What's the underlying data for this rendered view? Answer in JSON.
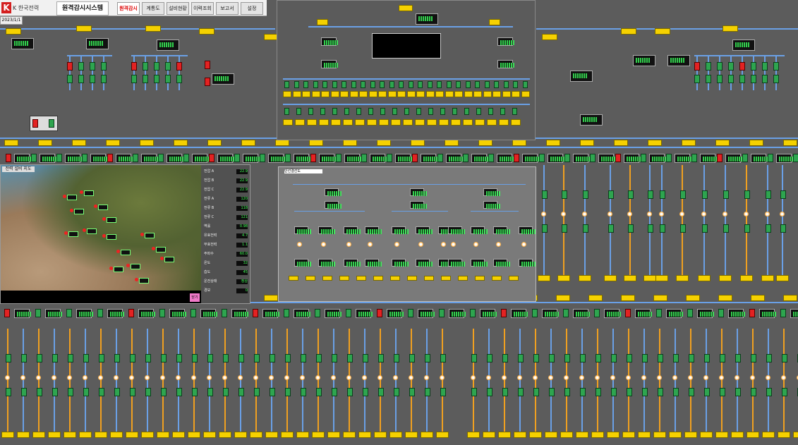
{
  "app": {
    "logo_text": "K 한국전력",
    "system_name": "원격감시시스템",
    "date_label": "2023/1/1"
  },
  "menu": [
    {
      "label": "원격감시",
      "active": true
    },
    {
      "label": "계통도",
      "active": false
    },
    {
      "label": "설비현황",
      "active": false
    },
    {
      "label": "이력조회",
      "active": false
    },
    {
      "label": "보고서",
      "active": false
    },
    {
      "label": "설정",
      "active": false
    }
  ],
  "map_panel": {
    "title": "전력 설비 지도",
    "pink_label": "닫기",
    "stats": [
      {
        "label": "전압 A",
        "value": "22.9"
      },
      {
        "label": "전압 B",
        "value": "22.9"
      },
      {
        "label": "전압 C",
        "value": "22.9"
      },
      {
        "label": "전류 A",
        "value": "120"
      },
      {
        "label": "전류 B",
        "value": "118"
      },
      {
        "label": "전류 C",
        "value": "121"
      },
      {
        "label": "역률",
        "value": "0.98"
      },
      {
        "label": "유효전력",
        "value": "4.7"
      },
      {
        "label": "무효전력",
        "value": "1.1"
      },
      {
        "label": "주파수",
        "value": "60.0"
      },
      {
        "label": "온도",
        "value": "32"
      },
      {
        "label": "습도",
        "value": "45"
      },
      {
        "label": "운전상태",
        "value": "정상"
      },
      {
        "label": "경보",
        "value": "0"
      }
    ]
  },
  "single_line_panel": {
    "title": "단선결선도"
  },
  "colors": {
    "bus": "#6aa0e6",
    "feeder": "#f0a020",
    "breaker_closed": "#2ea54f",
    "breaker_open": "#e32222",
    "tag": "#f5d100"
  }
}
